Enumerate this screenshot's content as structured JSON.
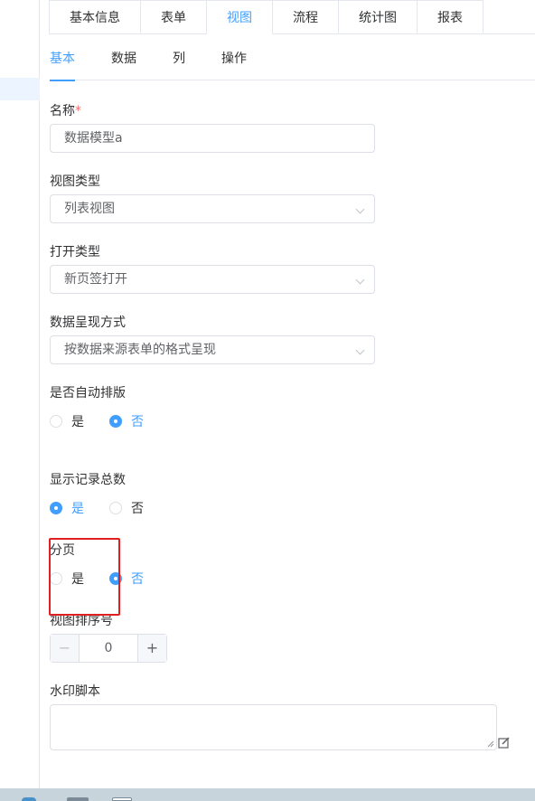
{
  "top_tabs": [
    {
      "label": "基本信息",
      "active": false
    },
    {
      "label": "表单",
      "active": false
    },
    {
      "label": "视图",
      "active": true
    },
    {
      "label": "流程",
      "active": false
    },
    {
      "label": "统计图",
      "active": false
    },
    {
      "label": "报表",
      "active": false
    }
  ],
  "sub_tabs": [
    {
      "label": "基本",
      "active": true
    },
    {
      "label": "数据",
      "active": false
    },
    {
      "label": "列",
      "active": false
    },
    {
      "label": "操作",
      "active": false
    }
  ],
  "form": {
    "name": {
      "label": "名称",
      "required_mark": "*",
      "value": "数据模型a"
    },
    "view_type": {
      "label": "视图类型",
      "value": "列表视图"
    },
    "open_type": {
      "label": "打开类型",
      "value": "新页签打开"
    },
    "data_display": {
      "label": "数据呈现方式",
      "value": "按数据来源表单的格式呈现"
    },
    "auto_layout": {
      "label": "是否自动排版",
      "yes": "是",
      "no": "否",
      "selected": "no"
    },
    "show_total": {
      "label": "显示记录总数",
      "yes": "是",
      "no": "否",
      "selected": "yes"
    },
    "pagination": {
      "label": "分页",
      "yes": "是",
      "no": "否",
      "selected": "no"
    },
    "view_order": {
      "label": "视图排序号",
      "value": "0",
      "minus": "−",
      "plus": "+"
    },
    "watermark": {
      "label": "水印脚本",
      "value": ""
    }
  },
  "colors": {
    "accent": "#409eff",
    "highlight_border": "#e02020",
    "required": "#f56c6c"
  }
}
